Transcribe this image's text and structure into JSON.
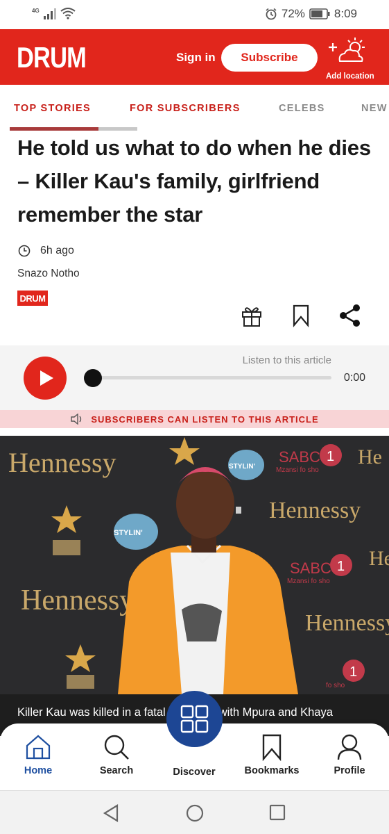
{
  "status_bar": {
    "network": "4G",
    "battery": "72%",
    "time": "8:09"
  },
  "header": {
    "logo": "DRUM",
    "sign_in": "Sign in",
    "subscribe": "Subscribe",
    "add_location": "Add location"
  },
  "tabs": [
    {
      "label": "TOP STORIES"
    },
    {
      "label": "FOR SUBSCRIBERS"
    },
    {
      "label": "CELEBS"
    },
    {
      "label": "NEW"
    }
  ],
  "article": {
    "headline": "He told us what to do when he dies – Killer Kau's family, girlfriend remember the star",
    "time_ago": "6h ago",
    "author": "Snazo Notho",
    "source_logo": "DRUM"
  },
  "audio": {
    "listen_label": "Listen to this article",
    "time": "0:00",
    "progress": 0,
    "subscribers_note": "SUBSCRIBERS CAN LISTEN TO THIS ARTICLE"
  },
  "photo": {
    "backdrop_words": [
      "Hennessy",
      "SABC",
      "STYLIN'",
      "Mzansi fo sho"
    ],
    "caption": "Killer Kau was killed in a fatal car crash with Mpura and Khaya"
  },
  "bottom_nav": {
    "home": "Home",
    "search": "Search",
    "discover": "Discover",
    "bookmarks": "Bookmarks",
    "profile": "Profile"
  },
  "colors": {
    "brand_red": "#e1261c",
    "nav_blue": "#1d4694",
    "audio_banner": "#f8d4d6"
  }
}
